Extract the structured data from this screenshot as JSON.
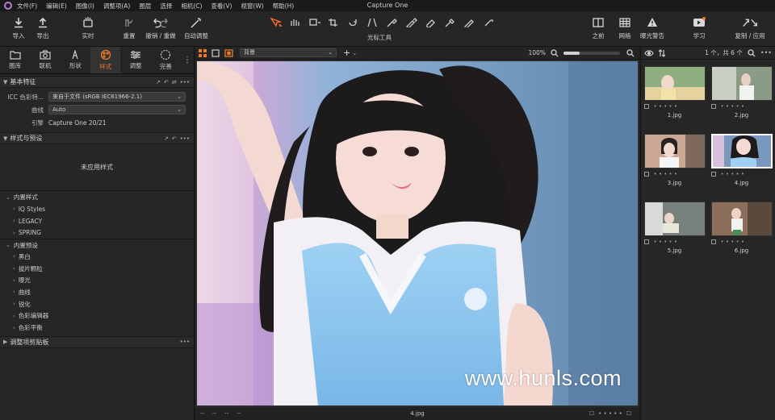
{
  "app": {
    "title": "Capture One"
  },
  "menu": [
    "文件(F)",
    "编辑(E)",
    "图像(I)",
    "调整项(A)",
    "图层",
    "选择",
    "相机(C)",
    "查看(V)",
    "视窗(W)",
    "帮助(H)"
  ],
  "toolbar": {
    "import": "导入",
    "export": "导出",
    "live": "实时",
    "redo": "重置",
    "undo_redo": "撤销 / 重做",
    "auto_adjust": "自动调整",
    "cursor_tools": "光标工具",
    "before": "之前",
    "grid": "网格",
    "exposure_warning": "曝光警告",
    "learn": "学习",
    "copy_apply": "复制 / 应用"
  },
  "left_tabs": [
    "图库",
    "联机",
    "形状",
    "样式",
    "调整",
    "完善"
  ],
  "active_left_tab": 3,
  "basic": {
    "title": "基本特征",
    "icc_label": "ICC 色彩特...",
    "icc_value": "来自于文件 (sRGB IEC61966-2.1)",
    "curve_label": "曲线",
    "curve_value": "Auto",
    "engine_label": "引擎",
    "engine_value": "Capture One 20/21"
  },
  "styles": {
    "title": "样式与预设",
    "empty": "未应用样式",
    "builtin_styles": "内置样式",
    "style_items": [
      "IQ Styles",
      "LEGACY",
      "SPRING"
    ],
    "builtin_presets": "内置预设",
    "preset_items": [
      "黑白",
      "拔片颗粒",
      "曝光",
      "曲线",
      "锐化",
      "色彩编辑器",
      "色彩平衡"
    ]
  },
  "clipboard_section": "调整项剪贴板",
  "viewer": {
    "background": "背景",
    "zoom": "100%",
    "zoom_fill": 0.28,
    "filename": "4.jpg",
    "meta": [
      "--",
      "--",
      "--",
      "--"
    ],
    "watermark": "www.hunls.com"
  },
  "browser": {
    "count": "1 个，共 6 个",
    "thumbs": [
      {
        "name": "1.jpg"
      },
      {
        "name": "2.jpg"
      },
      {
        "name": "3.jpg"
      },
      {
        "name": "4.jpg",
        "selected": true
      },
      {
        "name": "5.jpg"
      },
      {
        "name": "6.jpg"
      }
    ],
    "rating_dots": "• • • • •"
  },
  "colors": {
    "accent": "#f07a2a",
    "panel": "#262626",
    "menubar": "#1a1a1a"
  }
}
